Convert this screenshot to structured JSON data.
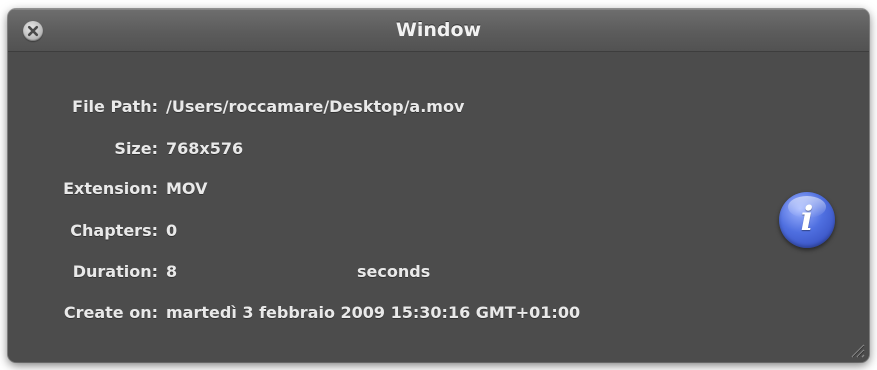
{
  "window": {
    "title": "Window"
  },
  "fields": [
    {
      "label": "File Path:",
      "value": "/Users/roccamare/Desktop/a.mov"
    },
    {
      "label": "Size:",
      "value": "768x576"
    },
    {
      "label": "Extension:",
      "value": "MOV"
    },
    {
      "label": "Chapters:",
      "value": "0"
    },
    {
      "label": "Duration:",
      "value": "8",
      "unit": "seconds"
    },
    {
      "label": "Create on:",
      "value": "martedì 3 febbraio 2009 15:30:16 GMT+01:00"
    }
  ],
  "icons": {
    "close": "close-icon",
    "info": "info-icon",
    "info_glyph": "i",
    "resize": "resize-grip-icon"
  },
  "colors": {
    "window_bg": "#4c4c4c",
    "titlebar": "#5c5c5c",
    "text": "#e9e9e9",
    "info_blue": "#4f6fe0"
  }
}
